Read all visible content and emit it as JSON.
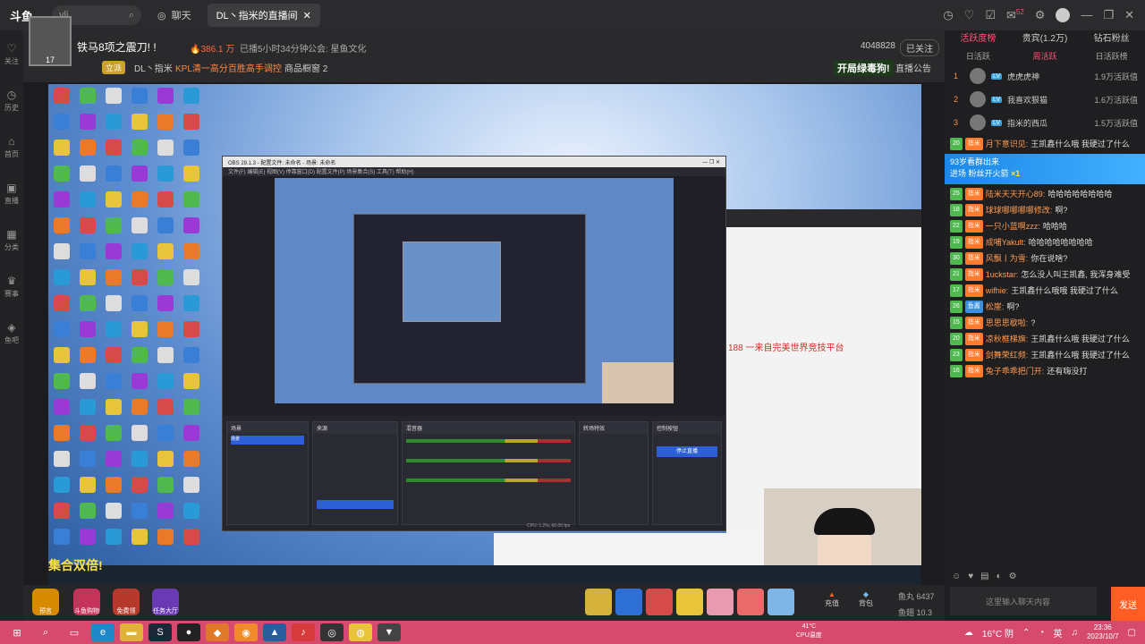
{
  "topbar": {
    "logo": "斗鱼",
    "search_placeholder": "yli",
    "tabs": [
      {
        "label": "聊天"
      },
      {
        "label": "DL丶指米的直播间"
      }
    ],
    "icons": [
      "clock-icon",
      "heart-icon",
      "task-icon",
      "gift-icon",
      "bag-icon",
      "avatar-icon",
      "minimize-icon",
      "restore-icon",
      "close-icon"
    ],
    "notif": "52"
  },
  "leftnav": [
    {
      "label": "关注"
    },
    {
      "label": "历史"
    },
    {
      "label": "首页"
    },
    {
      "label": "直播"
    },
    {
      "label": "分类"
    },
    {
      "label": "赛事"
    },
    {
      "label": "鱼吧"
    }
  ],
  "room": {
    "title": "铁马8项之震刀! !",
    "hot": "386.1 万",
    "live_time": "已播5小时34分钟",
    "company": "公会: 星鱼文化",
    "room_no": "4048828",
    "follow": "已关注",
    "level": "立派",
    "streamer": "DL丶指米",
    "kpl": "KPL清一高分百胜高手调控",
    "report": "商品橱窗 2",
    "promo": "开局绿毒狗!",
    "announce": "直播公告",
    "avatar_num": "17"
  },
  "obs": {
    "title": "OBS 29.1.3 - 配置文件: 未命名 - 场景: 未命名",
    "menu": "文件(F)  编辑(E)  视图(V)  停靠窗口(D)  配置文件(P)  场景集合(S)  工具(T)  帮助(H)",
    "sponsor_text": "集合双倍!",
    "docks": [
      "场景",
      "来源",
      "混音器",
      "转场特效",
      "控制按钮"
    ],
    "start_stream": "停止直播",
    "scene_name": "场景",
    "status": "CPU: 1.2%, 60.00 fps"
  },
  "browser": {
    "highlight": "188 一来自完美世界竞技平台"
  },
  "gifts": {
    "left": [
      {
        "label": "预言"
      },
      {
        "label": "斗鱼购物"
      },
      {
        "label": "免费领"
      },
      {
        "label": "任务大厅"
      }
    ],
    "recharge": "充值",
    "bag": "背包",
    "yuwan_label": "鱼丸",
    "yuwan": "6437",
    "yuchi_label": "鱼翅",
    "yuchi": "10.3"
  },
  "rightpanel": {
    "tabs": [
      "活跃度榜",
      "贵宾(1.2万)",
      "钻石粉丝"
    ],
    "subtabs": [
      "日活跃",
      "周活跃",
      "日活跃榜"
    ],
    "rank": [
      {
        "num": "1",
        "name": "虎虎虎神",
        "score": "1.9万活跃值"
      },
      {
        "num": "2",
        "name": "我喜欢狠猫",
        "score": "1.6万活跃值"
      },
      {
        "num": "3",
        "name": "指米的西瓜",
        "score": "1.5万活跃值"
      }
    ],
    "chats": [
      {
        "level": "20",
        "fan": "指米",
        "nick": "月下意识见:",
        "msg": "王凯鑫什么哦 我硬过了什么"
      },
      {
        "level": "25",
        "fan": "指米",
        "nick": "陆米天天开心89:",
        "msg": "哈哈哈哈哈哈哈哈"
      },
      {
        "level": "18",
        "fan": "指米",
        "nick": "球球哪哪哪哪修改:",
        "msg": "啊?"
      },
      {
        "level": "22",
        "fan": "指米",
        "nick": "一只小蓝啊zzz:",
        "msg": "哈哈哈"
      },
      {
        "level": "19",
        "fan": "指米",
        "nick": "成哺Yakult:",
        "msg": "哈哈哈哈哈哈哈哈"
      },
      {
        "level": "30",
        "fan": "指米",
        "nick": "风飘丨为雪:",
        "msg": "你在说啥?"
      },
      {
        "level": "21",
        "fan": "指米",
        "nick": "1uckstar:",
        "msg": "怎么没人叫王凯鑫, 我浑身难受"
      },
      {
        "level": "17",
        "fan": "指米",
        "nick": "wifhie:",
        "msg": "王凯鑫什么哦哦 我硬过了什么"
      },
      {
        "level": "26",
        "fan": "鱼酱",
        "nick": "松崖:",
        "msg": "啊?"
      },
      {
        "level": "15",
        "fan": "指米",
        "nick": "思思思歇啦:",
        "msg": "?"
      },
      {
        "level": "20",
        "fan": "指米",
        "nick": "凉秋框梯旗:",
        "msg": "王凯鑫什么哦 我硬过了什么"
      },
      {
        "level": "23",
        "fan": "指米",
        "nick": "剑舞荣红频:",
        "msg": "王凯鑫什么哦 我硬过了什么"
      },
      {
        "level": "16",
        "fan": "指米",
        "nick": "兔子乖乖把门开:",
        "msg": "还有嗨没打"
      }
    ],
    "gift_banner_line1": "93岁看群出来",
    "gift_banner_line2": "进场  粉丝开火箭",
    "gift_banner_count": "×1",
    "input_placeholder": "这里输入聊天内容",
    "send": "发送"
  },
  "taskbar": {
    "weather": "16°C 阴",
    "lang": "英",
    "time": "23:36",
    "date": "2023/10/7",
    "cpu_temp": "41°C",
    "cpu_label": "CPU温度"
  }
}
